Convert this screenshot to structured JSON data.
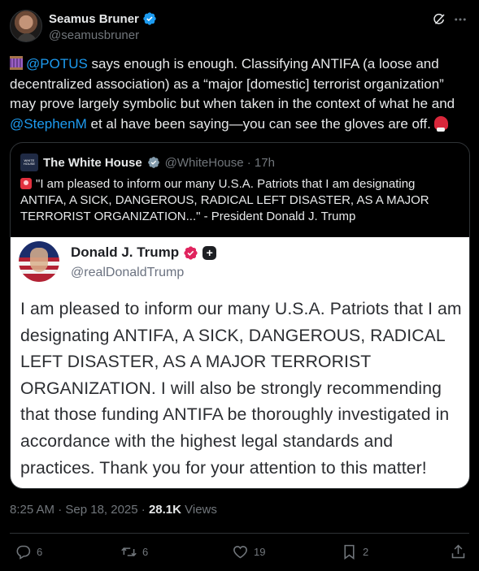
{
  "author": {
    "display_name": "Seamus Bruner",
    "handle": "@seamusbruner",
    "verified": true
  },
  "post": {
    "mention_potus": "@POTUS",
    "text_part1": " says enough is enough. Classifying ANTIFA (a loose and decentralized association) as a “major [domestic] terrorist organization” may prove largely symbolic but when taken in the context of what he and ",
    "mention_stephenm": "@StephenM",
    "text_part2": " et al have been saying—you can see the gloves are off."
  },
  "quoted_post": {
    "display_name": "The White House",
    "handle_time": "@WhiteHouse · 17h",
    "logo_text": "WHITE HOUSE",
    "text": "\"I am pleased to inform our many U.S.A. Patriots that I am designating ANTIFA, A SICK, DANGEROUS, RADICAL LEFT DISASTER, AS A MAJOR TERRORIST ORGANIZATION...\" - President Donald J. Trump",
    "image": {
      "display_name": "Donald J. Trump",
      "handle": "@realDonaldTrump",
      "body": "I am pleased to inform our many U.S.A. Patriots that I am designating ANTIFA, A SICK, DANGEROUS, RADICAL LEFT DISASTER, AS A MAJOR TERRORIST ORGANIZATION. I will also be strongly recommending that those funding ANTIFA be thoroughly investigated in accordance with the highest legal standards and practices. Thank you for your attention to this matter!"
    }
  },
  "meta": {
    "timestamp": "8:25 AM · Sep 18, 2025 · ",
    "views_count": "28.1K",
    "views_label": " Views"
  },
  "actions": {
    "replies": "6",
    "reposts": "6",
    "likes": "19",
    "bookmarks": "2"
  },
  "colors": {
    "background": "#000000",
    "text": "#e7e9ea",
    "muted": "#71767b",
    "accent": "#1d9bf0",
    "border": "#2f3336"
  }
}
